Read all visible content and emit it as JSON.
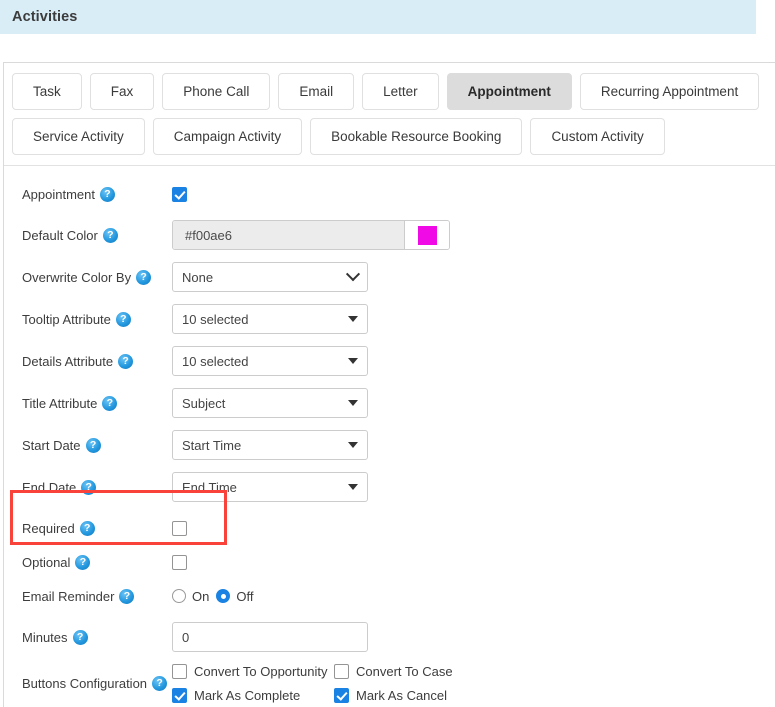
{
  "header": {
    "title": "Activities"
  },
  "tabs": {
    "rows": [
      [
        {
          "label": "Task",
          "active": false
        },
        {
          "label": "Fax",
          "active": false
        },
        {
          "label": "Phone Call",
          "active": false
        },
        {
          "label": "Email",
          "active": false
        },
        {
          "label": "Letter",
          "active": false
        },
        {
          "label": "Appointment",
          "active": true
        },
        {
          "label": "Recurring Appointment",
          "active": false
        }
      ],
      [
        {
          "label": "Service Activity",
          "active": false
        },
        {
          "label": "Campaign Activity",
          "active": false
        },
        {
          "label": "Bookable Resource Booking",
          "active": false
        },
        {
          "label": "Custom Activity",
          "active": false
        }
      ]
    ]
  },
  "help_icon_glyph": "?",
  "form": {
    "appointment": {
      "label": "Appointment",
      "checked": true
    },
    "default_color": {
      "label": "Default Color",
      "value": "#f00ae6",
      "swatch_color": "#f00ae6"
    },
    "overwrite_color_by": {
      "label": "Overwrite Color By",
      "value": "None"
    },
    "tooltip_attribute": {
      "label": "Tooltip Attribute",
      "value": "10 selected"
    },
    "details_attribute": {
      "label": "Details Attribute",
      "value": "10 selected"
    },
    "title_attribute": {
      "label": "Title Attribute",
      "value": "Subject"
    },
    "start_date": {
      "label": "Start Date",
      "value": "Start Time"
    },
    "end_date": {
      "label": "End Date",
      "value": "End Time"
    },
    "required": {
      "label": "Required",
      "checked": false
    },
    "optional": {
      "label": "Optional",
      "checked": false
    },
    "email_reminder": {
      "label": "Email Reminder",
      "options": [
        {
          "label": "On",
          "selected": false
        },
        {
          "label": "Off",
          "selected": true
        }
      ]
    },
    "minutes": {
      "label": "Minutes",
      "value": "0"
    },
    "buttons_configuration": {
      "label": "Buttons Configuration",
      "items": [
        {
          "label": "Convert To Opportunity",
          "checked": false
        },
        {
          "label": "Convert To Case",
          "checked": false
        },
        {
          "label": "Mark As Complete",
          "checked": true
        },
        {
          "label": "Mark As Cancel",
          "checked": true
        }
      ]
    }
  },
  "highlight": {
    "color": "#f9423a"
  }
}
